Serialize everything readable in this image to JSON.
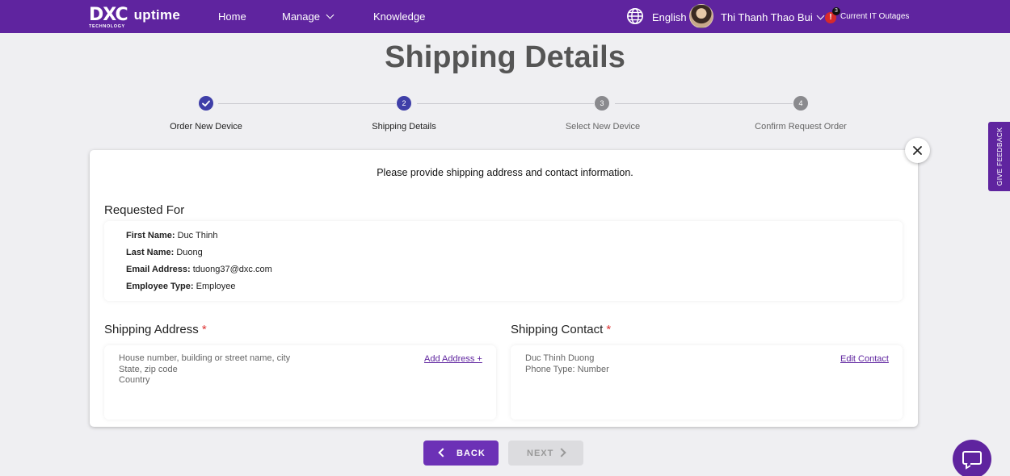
{
  "nav": {
    "logo_main": "DXC",
    "logo_sub": "TECHNOLOGY",
    "logo_product": "uptime",
    "home": "Home",
    "manage": "Manage",
    "knowledge": "Knowledge",
    "language": "English",
    "user_name": "Thi Thanh Thao Bui",
    "outage_count": "3",
    "outage_label": "Current IT Outages",
    "outage_icon_glyph": "!"
  },
  "page": {
    "title": "Shipping Details"
  },
  "stepper": {
    "steps": [
      {
        "number": "1",
        "label": "Order New Device",
        "state": "done"
      },
      {
        "number": "2",
        "label": "Shipping Details",
        "state": "active"
      },
      {
        "number": "3",
        "label": "Select New Device",
        "state": "todo"
      },
      {
        "number": "4",
        "label": "Confirm Request Order",
        "state": "todo"
      }
    ]
  },
  "card": {
    "intro": "Please provide shipping address and contact information.",
    "requested_for": {
      "title": "Requested For",
      "first_name_label": "First Name:",
      "first_name": "Duc Thinh",
      "last_name_label": "Last Name:",
      "last_name": "Duong",
      "email_label": "Email Address:",
      "email": "tduong37@dxc.com",
      "employee_type_label": "Employee Type:",
      "employee_type": "Employee"
    },
    "shipping_address": {
      "title": "Shipping Address",
      "required_mark": "*",
      "line1": "House number, building or street name, city",
      "line2": "State, zip code",
      "line3": "Country",
      "action": "Add Address +"
    },
    "shipping_contact": {
      "title": "Shipping Contact",
      "required_mark": "*",
      "name": "Duc Thinh Duong",
      "phone": "Phone Type: Number",
      "action": "Edit Contact"
    }
  },
  "buttons": {
    "back": "BACK",
    "next": "NEXT"
  },
  "feedback": {
    "label": "GIVE FEEDBACK"
  },
  "icons": {
    "close": "close-icon",
    "globe": "globe-icon",
    "chevron": "chevron-down-icon",
    "check": "check-icon",
    "chat": "chat-icon"
  },
  "colors": {
    "brand": "#5f249f",
    "step_active": "#3f3fa8",
    "step_todo": "#8a8a8e",
    "required": "#dd3333",
    "outage": "#d72a2a"
  }
}
